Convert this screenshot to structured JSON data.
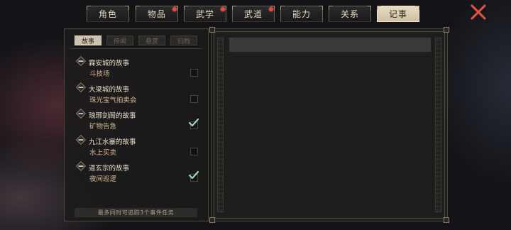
{
  "tabs": [
    {
      "label": "角色",
      "active": false,
      "badge": false
    },
    {
      "label": "物品",
      "active": false,
      "badge": true
    },
    {
      "label": "武学",
      "active": false,
      "badge": true
    },
    {
      "label": "武道",
      "active": false,
      "badge": true
    },
    {
      "label": "能力",
      "active": false,
      "badge": false
    },
    {
      "label": "关系",
      "active": false,
      "badge": false
    },
    {
      "label": "记事",
      "active": true,
      "badge": false
    }
  ],
  "close_icon": "close-x-icon",
  "subtabs": [
    {
      "label": "故事",
      "active": true
    },
    {
      "label": "传闻",
      "active": false
    },
    {
      "label": "悬赏",
      "active": false
    },
    {
      "label": "归档",
      "active": false
    }
  ],
  "stories": [
    {
      "title": "霖安城的故事",
      "task": "斗技场",
      "tracked": false
    },
    {
      "title": "大梁城的故事",
      "task": "珠光宝气拍卖会",
      "tracked": false
    },
    {
      "title": "琅琊剑阁的故事",
      "task": "矿物告急",
      "tracked": true
    },
    {
      "title": "九江水寨的故事",
      "task": "水上买卖",
      "tracked": false
    },
    {
      "title": "道玄宗的故事",
      "task": "夜间巡逻",
      "tracked": true
    }
  ],
  "footer_note": "最多同时可追踪3个事件任务",
  "colors": {
    "accent_active_tab": "#cdbf9f",
    "badge": "#e24a3b",
    "check": "#9fd6b0",
    "close": "#d9443a"
  }
}
